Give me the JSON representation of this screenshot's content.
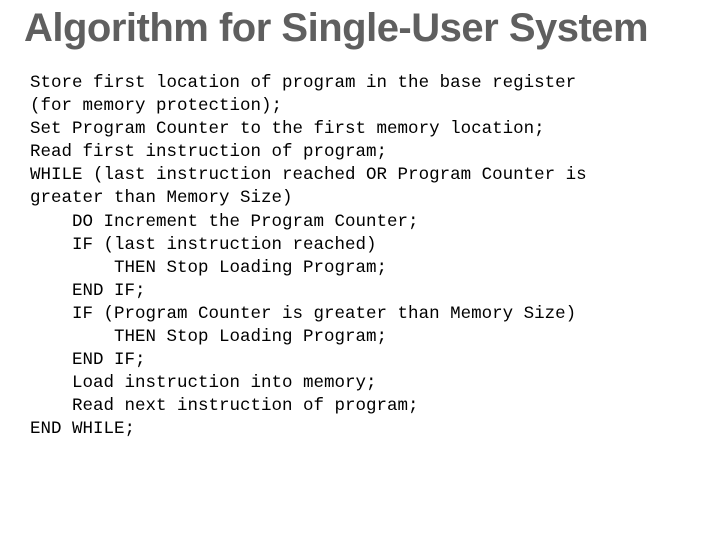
{
  "slide": {
    "title": "Algorithm for Single-User System",
    "algorithm_text": "Store first location of program in the base register\n(for memory protection);\nSet Program Counter to the first memory location;\nRead first instruction of program;\nWHILE (last instruction reached OR Program Counter is\ngreater than Memory Size)\n    DO Increment the Program Counter;\n    IF (last instruction reached)\n        THEN Stop Loading Program;\n    END IF;\n    IF (Program Counter is greater than Memory Size)\n        THEN Stop Loading Program;\n    END IF;\n    Load instruction into memory;\n    Read next instruction of program;\nEND WHILE;"
  }
}
